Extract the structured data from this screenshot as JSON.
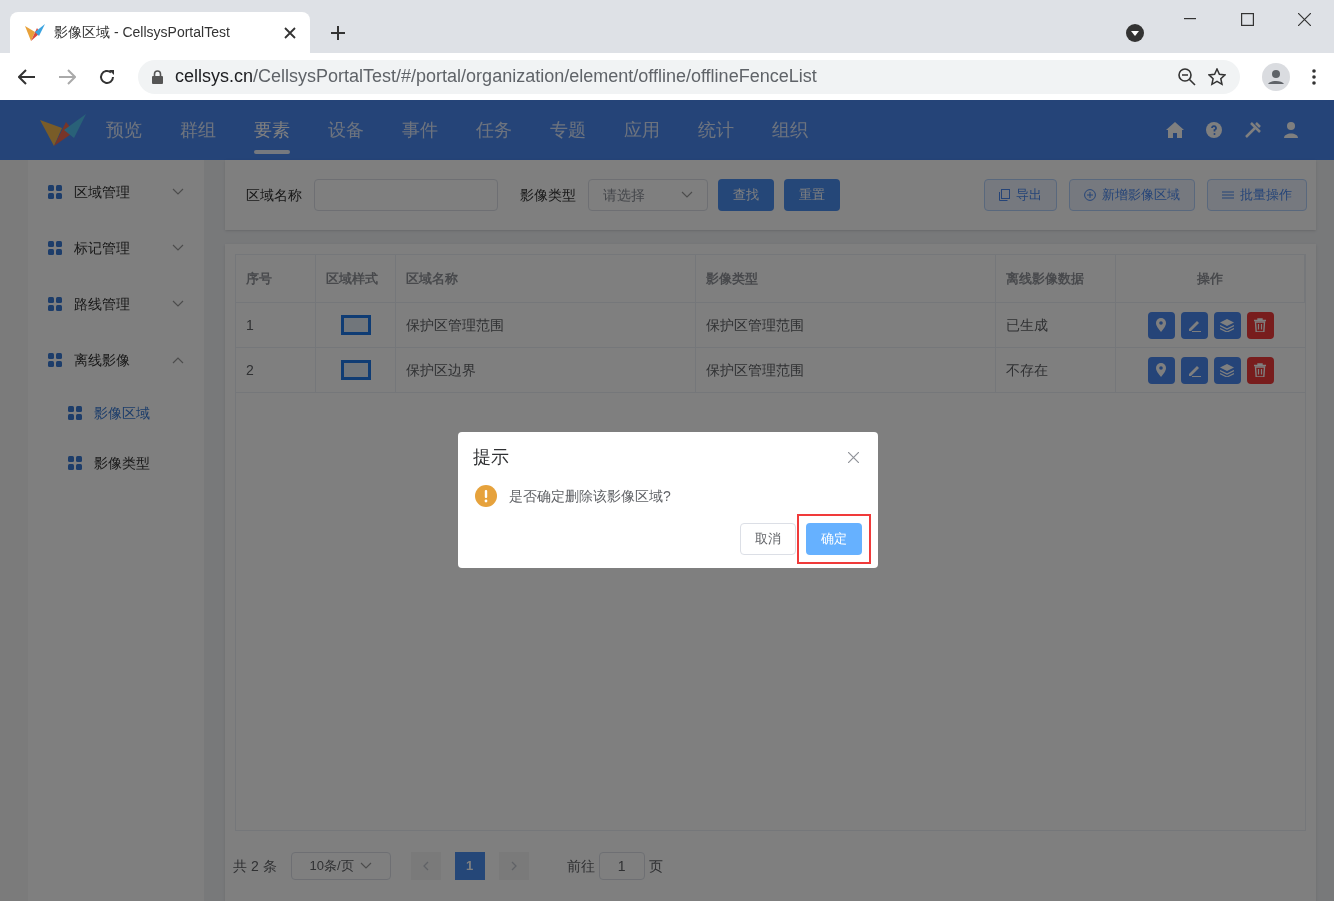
{
  "browser": {
    "tab_title": "影像区域 - CellsysPortalTest",
    "url_host": "cellsys.cn",
    "url_path": "/CellsysPortalTest/#/portal/organization/element/offline/offlineFenceList"
  },
  "nav": {
    "items": [
      {
        "label": "预览",
        "selected": false
      },
      {
        "label": "群组",
        "selected": false
      },
      {
        "label": "要素",
        "selected": true
      },
      {
        "label": "设备",
        "selected": false
      },
      {
        "label": "事件",
        "selected": false
      },
      {
        "label": "任务",
        "selected": false
      },
      {
        "label": "专题",
        "selected": false
      },
      {
        "label": "应用",
        "selected": false
      },
      {
        "label": "统计",
        "selected": false
      },
      {
        "label": "组织",
        "selected": false
      }
    ]
  },
  "sidebar": {
    "items": [
      {
        "label": "区域管理",
        "expanded": false
      },
      {
        "label": "标记管理",
        "expanded": false
      },
      {
        "label": "路线管理",
        "expanded": false
      },
      {
        "label": "离线影像",
        "expanded": true,
        "children": [
          {
            "label": "影像区域",
            "selected": true
          },
          {
            "label": "影像类型",
            "selected": false
          }
        ]
      }
    ]
  },
  "filters": {
    "name_label": "区域名称",
    "type_label": "影像类型",
    "type_placeholder": "请选择",
    "buttons": [
      "查找",
      "重置"
    ],
    "actions": [
      {
        "label": "导出",
        "kind": "export"
      },
      {
        "label": "新增影像区域",
        "kind": "add"
      },
      {
        "label": "批量操作",
        "kind": "batch"
      }
    ]
  },
  "table": {
    "columns": [
      "序号",
      "区域样式",
      "区域名称",
      "影像类型",
      "离线影像数据",
      "操作"
    ],
    "rows": [
      {
        "index": "1",
        "name": "保护区管理范围",
        "type": "保护区管理范围",
        "data": "已生成"
      },
      {
        "index": "2",
        "name": "保护区边界",
        "type": "保护区管理范围",
        "data": "不存在"
      }
    ]
  },
  "pagination": {
    "total": "共 2 条",
    "page_size": "10条/页",
    "pages": [
      {
        "label": "1",
        "selected": true
      }
    ],
    "goto_label": "前往",
    "goto_value": "1",
    "goto_suffix": "页"
  },
  "dialog": {
    "title": "提示",
    "message": "是否确定删除该影像区域?",
    "buttons": [
      {
        "label": "取消",
        "kind": "cancel"
      },
      {
        "label": "确定",
        "kind": "primary"
      }
    ]
  }
}
